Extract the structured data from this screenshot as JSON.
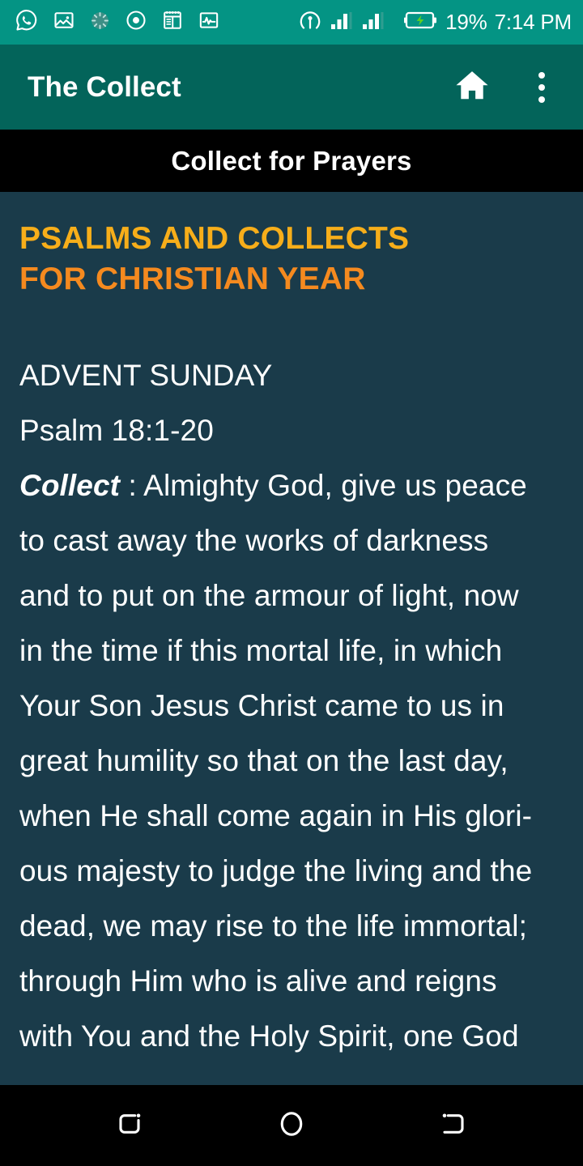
{
  "status_bar": {
    "background": "#049484",
    "left_icons": [
      {
        "name": "whatsapp-icon"
      },
      {
        "name": "image-icon"
      },
      {
        "name": "sync-spinner-icon"
      },
      {
        "name": "record-target-icon"
      },
      {
        "name": "notepad-icon"
      },
      {
        "name": "activity-pulse-icon"
      }
    ],
    "right_icons": [
      {
        "name": "hotspot-icon"
      },
      {
        "name": "signal-bars-sim1-icon"
      },
      {
        "name": "signal-bars-sim2-icon"
      },
      {
        "name": "battery-charging-icon"
      }
    ],
    "battery_percent": "19%",
    "clock": "7:14 PM",
    "battery_bolt_color": "#5ed020"
  },
  "app_bar": {
    "background": "#03645a",
    "title": "The Collect",
    "home_icon": "home-icon",
    "overflow_icon": "more-vertical-icon"
  },
  "sub_bar": {
    "background": "#000000",
    "title": "Collect for Prayers"
  },
  "content": {
    "background": "#1a3b4a",
    "heading": {
      "line1": "PSALMS AND COLLECTS",
      "line1_color": "#f7ae1a",
      "line2": "FOR CHRISTIAN YEAR",
      "line2_color": "#f58a1f"
    },
    "entry": {
      "day": "ADVENT SUNDAY",
      "psalm": "Psalm 18:1-20",
      "collect_label": "Collect",
      "collect_separator": " : ",
      "collect_lines": [
        "Almighty God, give us peace",
        "to cast away the works of darkness",
        "and to put on the armour of light, now",
        "in the time if this mortal life, in which",
        "Your Son Jesus Christ came to us in",
        "great humility so that on the last day,",
        "when He shall come again in His glori-",
        "ous majesty to judge the living and the",
        "dead, we may rise to the life immortal;",
        "through Him who is alive and reigns",
        "with You and the Holy Spirit, one God"
      ]
    }
  },
  "nav_bar": {
    "background": "#000000",
    "buttons": [
      {
        "name": "recents-button"
      },
      {
        "name": "home-button"
      },
      {
        "name": "back-button"
      }
    ]
  }
}
